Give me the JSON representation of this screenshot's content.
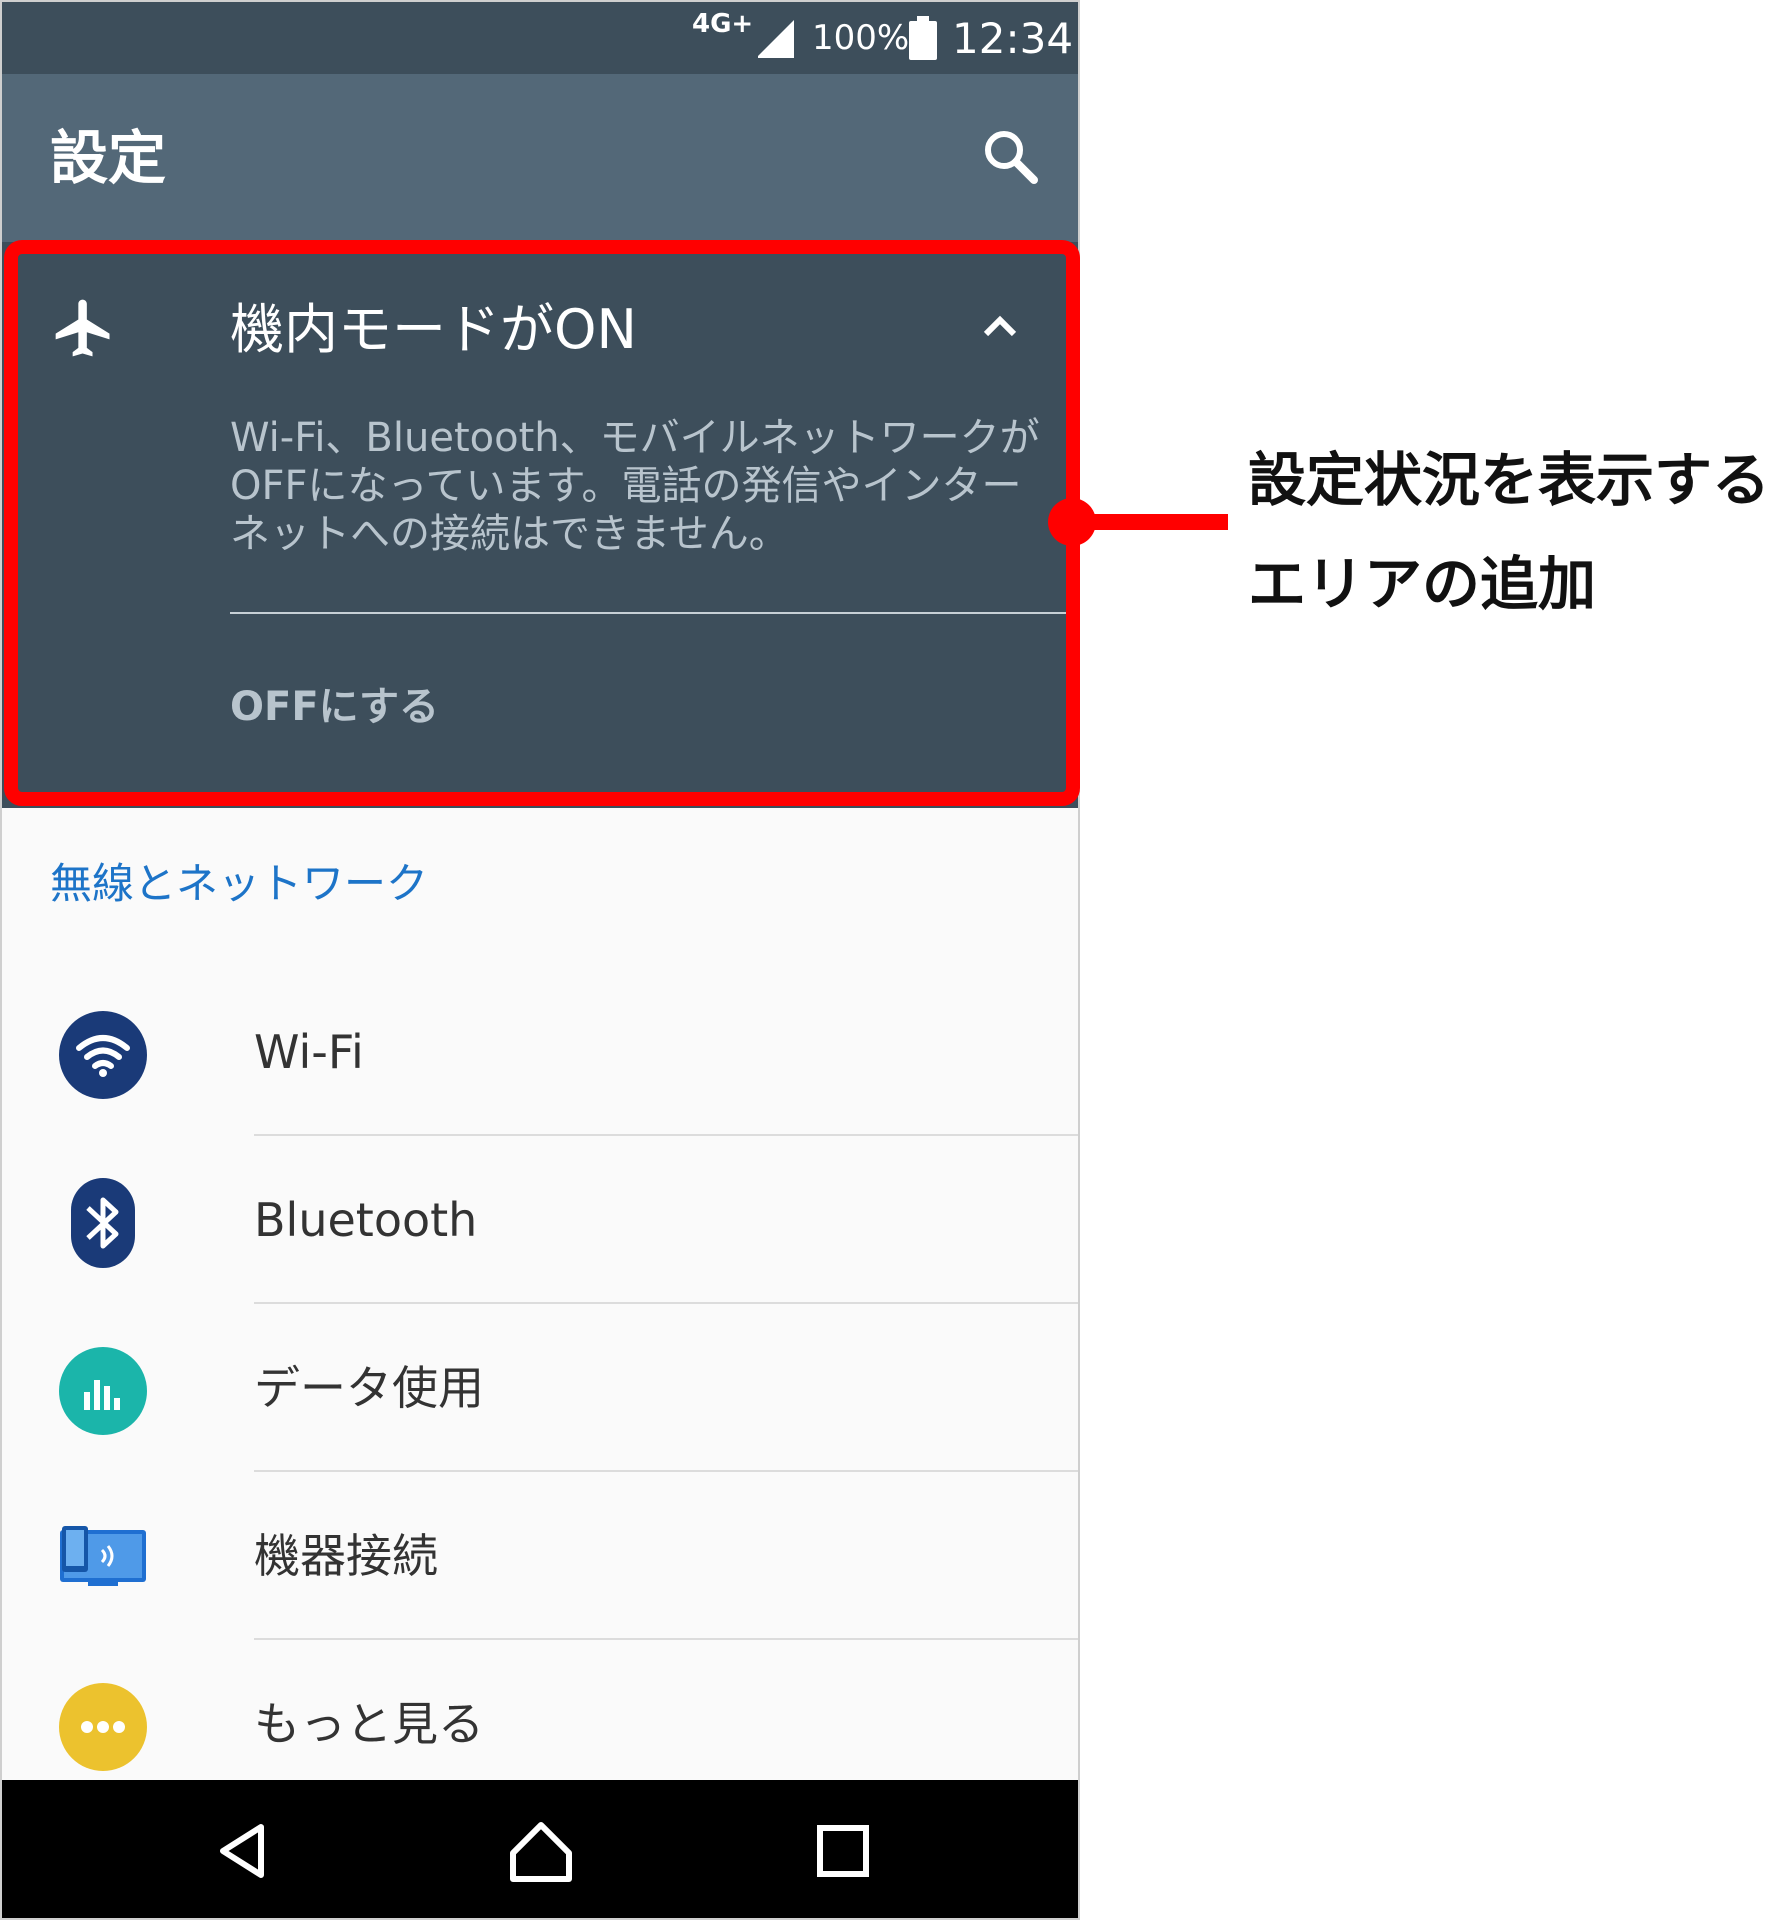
{
  "status_bar": {
    "network": "4G+",
    "battery_pct": "100%",
    "time": "12:34",
    "icons": [
      "signal-icon",
      "battery-icon"
    ]
  },
  "app_bar": {
    "title": "設定",
    "search_icon": "search-icon"
  },
  "airplane_card": {
    "icon": "airplane-icon",
    "title": "機内モードがON",
    "collapse_icon": "chevron-up-icon",
    "description": "Wi-Fi、Bluetooth、モバイルネットワークがOFFになっています。電話の発信やインターネットへの接続はできません。",
    "action_label": "OFFにする"
  },
  "section": {
    "header": "無線とネットワーク",
    "items": [
      {
        "label": "Wi-Fi",
        "icon": "wifi-icon"
      },
      {
        "label": "Bluetooth",
        "icon": "bluetooth-icon"
      },
      {
        "label": "データ使用",
        "icon": "data-usage-icon"
      },
      {
        "label": "機器接続",
        "icon": "device-connection-icon"
      },
      {
        "label": "もっと見る",
        "icon": "more-icon"
      }
    ]
  },
  "nav_bar": {
    "icons": [
      "back-icon",
      "home-icon",
      "recents-icon"
    ]
  },
  "annotation": {
    "line1": "設定状況を表示する",
    "line2": "エリアの追加"
  },
  "colors": {
    "status_bar": "#3d4e5b",
    "app_bar": "#536878",
    "card": "#3d4e5b",
    "highlight": "#ff0000",
    "section_header": "#1d74c8"
  }
}
